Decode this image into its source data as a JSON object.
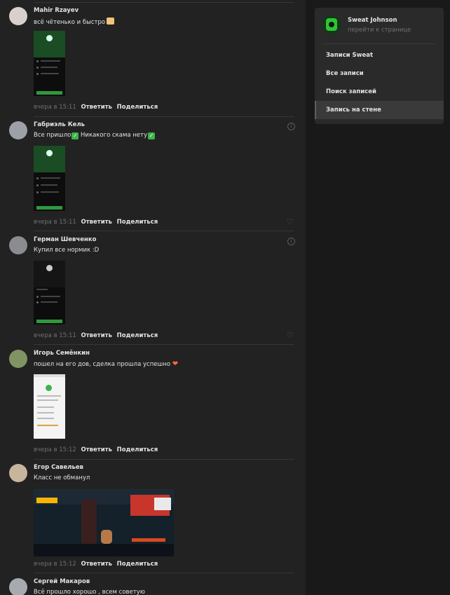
{
  "comments": [
    {
      "author": "Mahir Rzayev",
      "text": "всё чётенько и быстро",
      "time": "вчера в 15:11",
      "reply": "Ответить",
      "share": "Поделиться",
      "avatar_color": "#d8d0cc",
      "emoji": [
        "thumbs-up"
      ]
    },
    {
      "author": "Габриэль Кель",
      "text_parts": [
        "Все пришло",
        " Никакого скама нету"
      ],
      "time": "вчера в 15:11",
      "reply": "Ответить",
      "share": "Поделиться",
      "avatar_color": "#9da0a6",
      "emoji": [
        "check-mark",
        "check-mark"
      ]
    },
    {
      "author": "Герман Шевченко",
      "text": "Купил все нормик :D",
      "time": "вчера в 15:11",
      "reply": "Ответить",
      "share": "Поделиться",
      "avatar_color": "#8a8c90"
    },
    {
      "author": "Игорь Семёнкин",
      "text": "пошел на его дов, сделка прошла успешно",
      "time": "вчера в 15:12",
      "reply": "Ответить",
      "share": "Поделиться",
      "avatar_color": "#7f9462",
      "emoji": [
        "heart"
      ]
    },
    {
      "author": "Егор Савельев",
      "text": "Класс не обманул",
      "time": "вчера в 15:12",
      "reply": "Ответить",
      "share": "Поделиться",
      "avatar_color": "#c7b59e"
    },
    {
      "author": "Сергей Макаров",
      "text": "Всё прошло хорошо , всем советую",
      "avatar_color": "#a7aaae"
    }
  ],
  "sidebar": {
    "name": "Sweat Johnson",
    "link": "перейти к странице",
    "menu": [
      {
        "label": "Записи Sweat",
        "active": false
      },
      {
        "label": "Все записи",
        "active": false
      },
      {
        "label": "Поиск записей",
        "active": false
      },
      {
        "label": "Запись на стене",
        "active": true
      }
    ]
  },
  "icons": {
    "info": "info-icon",
    "like": "heart-outline-icon"
  },
  "colors": {
    "background": "#191919",
    "feed": "#222222",
    "card": "#2a2a2a",
    "text": "#e1e3e6",
    "muted": "#6d7075"
  }
}
